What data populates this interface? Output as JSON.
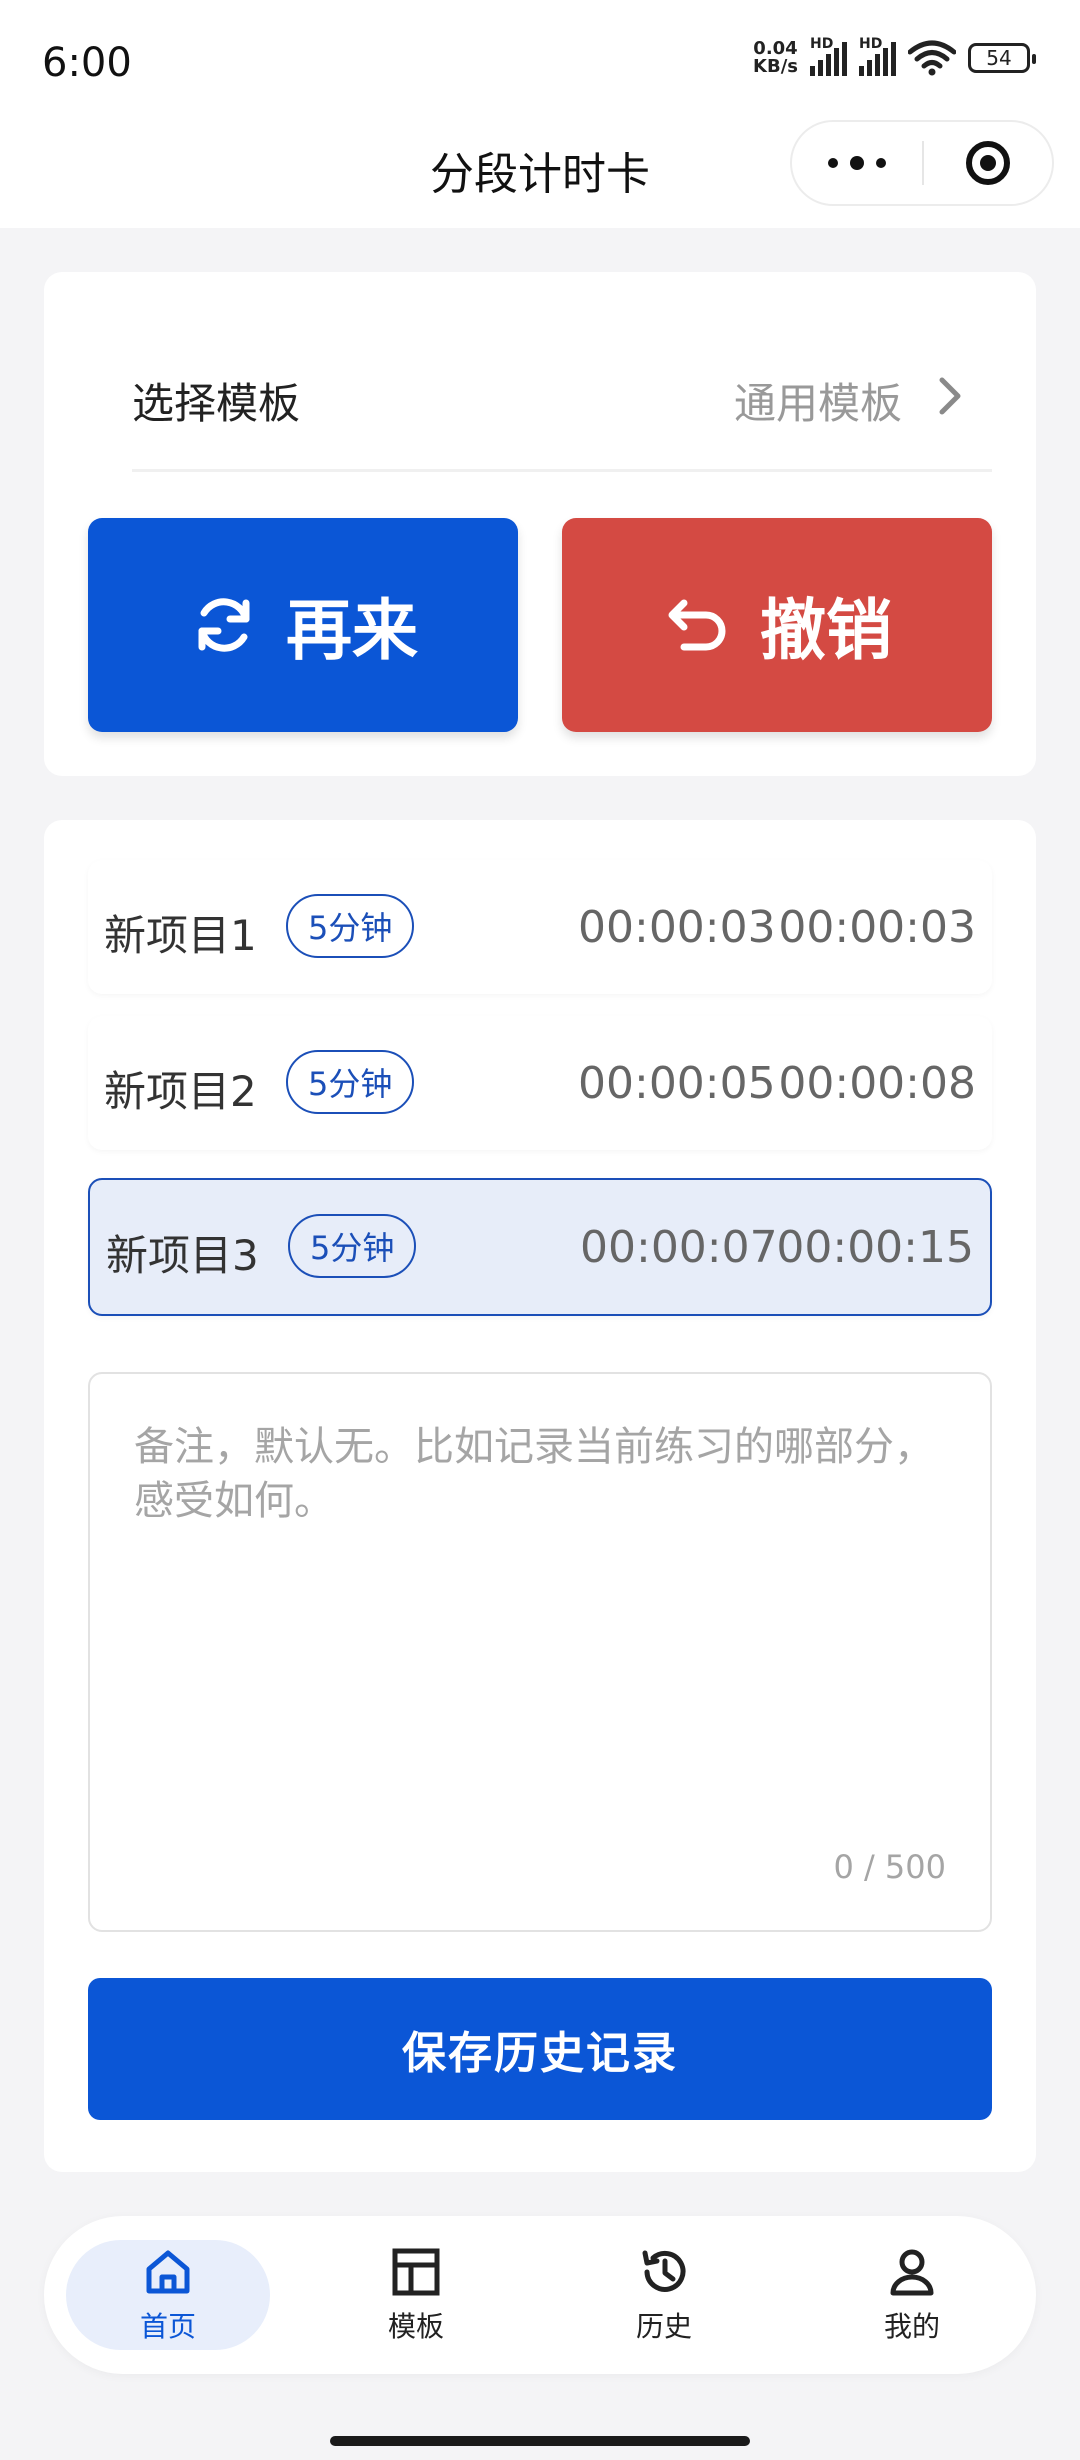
{
  "status": {
    "time": "6:00",
    "netspeed_value": "0.04",
    "netspeed_unit": "KB/s",
    "sim1": "HD",
    "sim2": "HD",
    "battery": "54"
  },
  "navbar": {
    "title": "分段计时卡"
  },
  "template": {
    "label": "选择模板",
    "value": "通用模板"
  },
  "actions": {
    "again_label": "再来",
    "undo_label": "撤销"
  },
  "items": [
    {
      "name": "新项目1",
      "badge": "5分钟",
      "elapsed": "00:00:03",
      "total": "00:00:03"
    },
    {
      "name": "新项目2",
      "badge": "5分钟",
      "elapsed": "00:00:05",
      "total": "00:00:08"
    },
    {
      "name": "新项目3",
      "badge": "5分钟",
      "elapsed": "00:00:07",
      "total": "00:00:15"
    }
  ],
  "note": {
    "placeholder": "备注，默认无。比如记录当前练习的哪部分，感受如何。",
    "counter": "0 / 500"
  },
  "save_label": "保存历史记录",
  "tabs": [
    {
      "label": "首页",
      "icon": "home-icon"
    },
    {
      "label": "模板",
      "icon": "template-icon"
    },
    {
      "label": "历史",
      "icon": "history-icon"
    },
    {
      "label": "我的",
      "icon": "user-icon"
    }
  ],
  "colors": {
    "primary": "#0b56d6",
    "danger": "#d44a43",
    "active_bg": "#e7edf9"
  }
}
